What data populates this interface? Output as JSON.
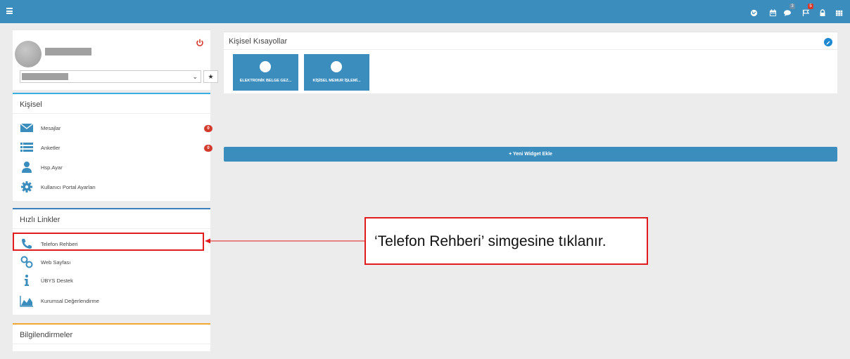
{
  "colors": {
    "topbar": "#3b8dbd",
    "accent_blue": "#3ab0e2",
    "badge_red": "#d33a2c",
    "highlight_red": "#e01c1c",
    "orange": "#f0a830"
  },
  "topbar": {
    "menu_icon": "hamburger-icon",
    "icons": [
      {
        "name": "globe-icon"
      },
      {
        "name": "calendar-icon"
      },
      {
        "name": "chat-icon",
        "badge": "3"
      },
      {
        "name": "flag-icon",
        "badge": "5"
      },
      {
        "name": "lock-icon"
      },
      {
        "name": "grid-icon"
      }
    ]
  },
  "kisisel": {
    "title": "Kişisel",
    "items": [
      {
        "label": "Mesajlar",
        "icon": "envelope-icon",
        "badge": "0"
      },
      {
        "label": "Anketler",
        "icon": "list-icon",
        "badge": "0"
      },
      {
        "label": "Hsp.Ayar",
        "icon": "user-icon"
      },
      {
        "label": "Kullanıcı Portal Ayarları",
        "icon": "gear-icon"
      }
    ]
  },
  "hizli_linkler": {
    "title": "Hızlı Linkler",
    "items": [
      {
        "label": "Telefon Rehberi",
        "icon": "phone-icon"
      },
      {
        "label": "Web Sayfası",
        "icon": "link-icon"
      },
      {
        "label": "ÜBYS Destek",
        "icon": "info-icon"
      },
      {
        "label": "Kurumsal Değerlendirme",
        "icon": "area-chart-icon"
      }
    ]
  },
  "bilgilendirmeler": {
    "title": "Bilgilendirmeler"
  },
  "shortcuts": {
    "title": "Kişisel Kısayollar",
    "tiles": [
      {
        "label": "ELEKTRONİK BELGE GEZ..."
      },
      {
        "label": "KİŞİSEL MEMUR İŞLEMİ..."
      }
    ]
  },
  "widget_button": "+ Yeni Widget Ekle",
  "callout": "‘Telefon Rehberi’ simgesine tıklanır."
}
